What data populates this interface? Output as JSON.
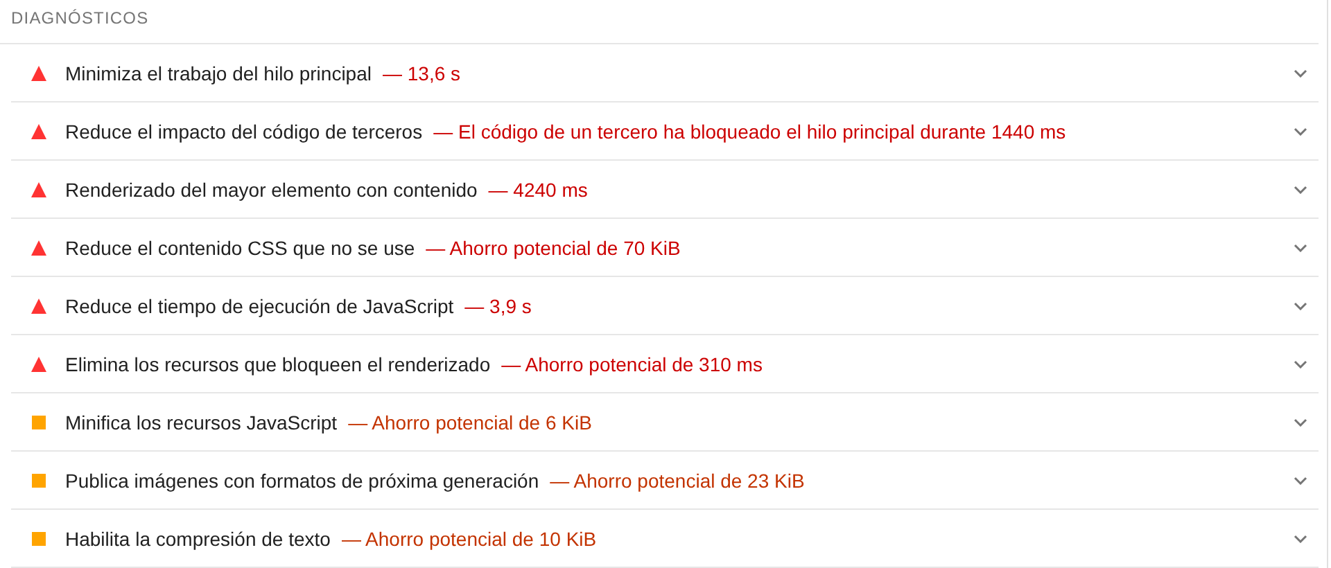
{
  "section_title": "DIAGNÓSTICOS",
  "audits": [
    {
      "kind": "fail",
      "title": "Minimiza el trabajo del hilo principal",
      "detail": "— 13,6 s"
    },
    {
      "kind": "fail",
      "title": "Reduce el impacto del código de terceros",
      "detail": "— El código de un tercero ha bloqueado el hilo principal durante 1440 ms"
    },
    {
      "kind": "fail",
      "title": "Renderizado del mayor elemento con contenido",
      "detail": "— 4240 ms"
    },
    {
      "kind": "fail",
      "title": "Reduce el contenido CSS que no se use",
      "detail": "— Ahorro potencial de 70 KiB"
    },
    {
      "kind": "fail",
      "title": "Reduce el tiempo de ejecución de JavaScript",
      "detail": "— 3,9 s"
    },
    {
      "kind": "fail",
      "title": "Elimina los recursos que bloqueen el renderizado",
      "detail": "— Ahorro potencial de 310 ms"
    },
    {
      "kind": "average",
      "title": "Minifica los recursos JavaScript",
      "detail": "— Ahorro potencial de 6 KiB"
    },
    {
      "kind": "average",
      "title": "Publica imágenes con formatos de próxima generación",
      "detail": "— Ahorro potencial de 23 KiB"
    },
    {
      "kind": "average",
      "title": "Habilita la compresión de texto",
      "detail": "— Ahorro potencial de 10 KiB"
    }
  ]
}
